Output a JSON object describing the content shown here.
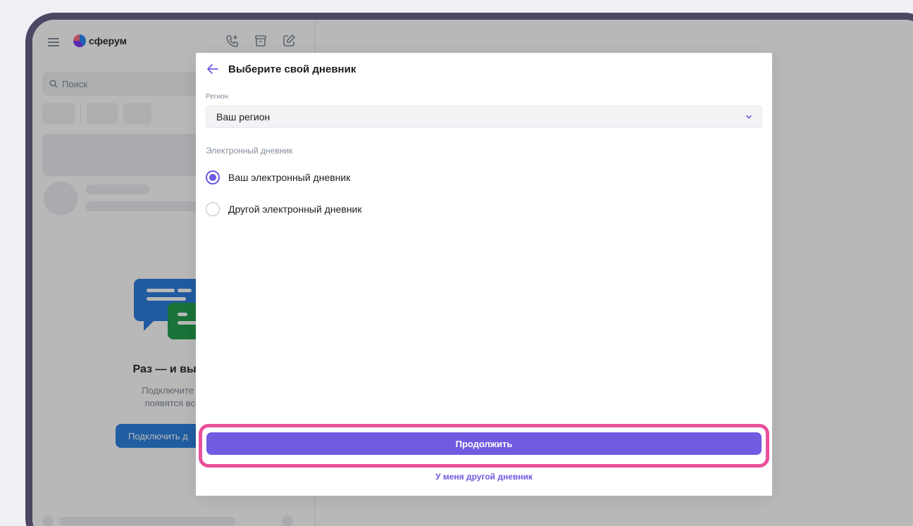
{
  "app": {
    "logo_text": "сферум",
    "search_placeholder": "Поиск",
    "empty_state": {
      "title": "Раз — и вы в нуж",
      "description_line1": "Подключите дневн",
      "description_line2": "появятся все нуж",
      "button_label": "Подключить д"
    }
  },
  "modal": {
    "title": "Выберите свой дневник",
    "region_label": "Регион",
    "region_value": "Ваш регион",
    "diary_label": "Электронный дневник",
    "options": [
      {
        "label": "Ваш электронный дневник",
        "checked": true
      },
      {
        "label": "Другой электронный дневник",
        "checked": false
      }
    ],
    "continue_label": "Продолжить",
    "other_link": "У меня другой дневник"
  },
  "colors": {
    "accent": "#6f5ce0",
    "highlight": "#e8519c",
    "frame": "#4d4763"
  }
}
